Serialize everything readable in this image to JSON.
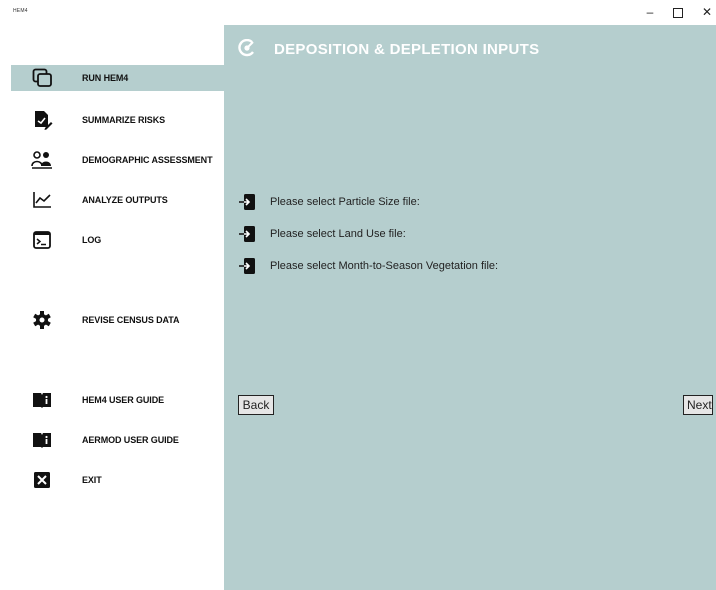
{
  "window": {
    "title": "HEM4",
    "controls": {
      "minimize": "–",
      "close": "✕"
    }
  },
  "sidebar": {
    "items": [
      {
        "label": "RUN HEM4",
        "icon": "copy-icon",
        "active": true
      },
      {
        "label": "SUMMARIZE RISKS",
        "icon": "file-edit-icon",
        "active": false
      },
      {
        "label": "DEMOGRAPHIC ASSESSMENT",
        "icon": "people-icon",
        "active": false
      },
      {
        "label": "ANALYZE OUTPUTS",
        "icon": "line-chart-icon",
        "active": false
      },
      {
        "label": "LOG",
        "icon": "terminal-icon",
        "active": false
      },
      {
        "label": "REVISE CENSUS DATA",
        "icon": "gear-icon",
        "active": false
      },
      {
        "label": "HEM4 USER GUIDE",
        "icon": "book-info-icon",
        "active": false
      },
      {
        "label": "AERMOD USER GUIDE",
        "icon": "book-info-icon",
        "active": false
      },
      {
        "label": "EXIT",
        "icon": "close-box-icon",
        "active": false
      }
    ]
  },
  "main": {
    "title": "DEPOSITION & DEPLETION INPUTS",
    "file_prompts": [
      {
        "label": "Please select Particle Size file:",
        "icon": "file-import-icon"
      },
      {
        "label": "Please select Land Use file:",
        "icon": "file-import-icon"
      },
      {
        "label": "Please select Month-to-Season Vegetation file:",
        "icon": "file-import-icon"
      }
    ],
    "back_label": "Back",
    "next_label": "Next"
  },
  "colors": {
    "panel_bg": "#b5cece",
    "active_nav_bg": "#b5cece",
    "title_color": "#ffffff"
  }
}
